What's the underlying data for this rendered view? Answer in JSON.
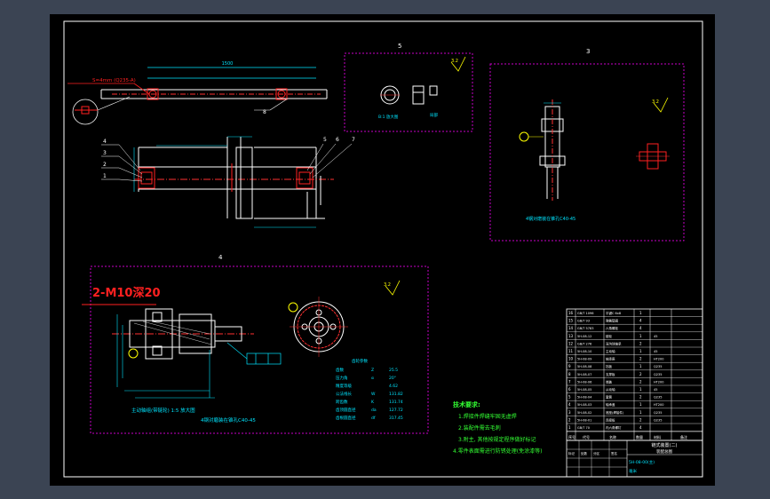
{
  "colors": {
    "workspace_bg": "#3b4453",
    "paper": "#000000",
    "frame": "#ffffff",
    "section_box": "#c800c8",
    "part_red": "#ff2020",
    "dim": "#00e5ff",
    "part": "#ffffff",
    "centerline": "#ff3030",
    "text_yellow": "#ffff00",
    "text_green": "#33ff33"
  },
  "views": {
    "section5_label": "5",
    "section3_label": "3",
    "section4_label": "4",
    "roughness_value": "3.2",
    "overall_length": "1500"
  },
  "main_view": {
    "callout_left_text": "S=4mm (Q235-A)",
    "balloons_left": [
      "4",
      "3",
      "2",
      "1"
    ],
    "balloons_right": [
      "5",
      "6",
      "7"
    ],
    "balloon_top_right": "8"
  },
  "detail5": {
    "caption_left": "B:1 放大图",
    "caption_right": "局部"
  },
  "detail3": {
    "caption": "4钢对磨装在锥孔C40-45"
  },
  "detail4": {
    "thread_note": "2-M10深20",
    "caption_left": "主动轴组(带链轮) 1:5 放大图",
    "caption_center": "4钢对磨装在锥孔C40-45"
  },
  "params_table": {
    "title": "齿轮参数",
    "rows": [
      {
        "name": "齿数",
        "sym": "Z",
        "val": "25.5"
      },
      {
        "name": "压力角",
        "sym": "α",
        "val": "20°"
      },
      {
        "name": "精度等级",
        "sym": "",
        "val": "4.62"
      },
      {
        "name": "公法线长",
        "sym": "W",
        "val": "131.82"
      },
      {
        "name": "跨齿数",
        "sym": "K",
        "val": "131.74"
      },
      {
        "name": "齿顶圆直径",
        "sym": "da",
        "val": "127.72"
      },
      {
        "name": "齿根圆直径",
        "sym": "df",
        "val": "317.45"
      }
    ]
  },
  "tech_notes": {
    "heading": "技术要求:",
    "items": [
      "1.焊接件焊缝牢固无虚焊",
      "2.装配件需去毛刺",
      "3.附主, 其他按规定程序做好标记",
      "4.零件表面需进行防锈处理(免涂漆等)"
    ]
  },
  "title_block": {
    "drawing_title": "链式装置(二)",
    "subtitle": "装配总图",
    "drawing_no": "5H-08-00(主)",
    "units": "毫米",
    "footer_labels": [
      "序号",
      "代号",
      "名称",
      "数量",
      "材料",
      "备注"
    ],
    "small_labels": [
      "标记",
      "处数",
      "分区",
      "更改文件号",
      "签名",
      "年月日"
    ]
  },
  "bom": [
    {
      "no": "16",
      "code": "GB/T 1096",
      "name": "平键C 6x8",
      "qty": "1",
      "mat": ""
    },
    {
      "no": "15",
      "code": "GB/T 93",
      "name": "弹簧垫圈",
      "qty": "4",
      "mat": ""
    },
    {
      "no": "14",
      "code": "GB/T 5783",
      "name": "六角螺栓",
      "qty": "4",
      "mat": ""
    },
    {
      "no": "13",
      "code": "5H-08-12",
      "name": "链轮",
      "qty": "1",
      "mat": "45"
    },
    {
      "no": "12",
      "code": "GB/T 276",
      "name": "深沟球轴承",
      "qty": "2",
      "mat": ""
    },
    {
      "no": "11",
      "code": "5H-08-10",
      "name": "主动轴",
      "qty": "1",
      "mat": "45"
    },
    {
      "no": "10",
      "code": "5H-08-09",
      "name": "轴承座",
      "qty": "2",
      "mat": "HT200"
    },
    {
      "no": "9",
      "code": "5H-08-08",
      "name": "挡板",
      "qty": "1",
      "mat": "Q235"
    },
    {
      "no": "8",
      "code": "5H-08-07",
      "name": "支撑板",
      "qty": "2",
      "mat": "Q235"
    },
    {
      "no": "7",
      "code": "5H-08-06",
      "name": "端盖",
      "qty": "2",
      "mat": "HT200"
    },
    {
      "no": "6",
      "code": "5H-08-05",
      "name": "从动轴",
      "qty": "1",
      "mat": "45"
    },
    {
      "no": "5",
      "code": "5H-08-04",
      "name": "套筒",
      "qty": "2",
      "mat": "Q235"
    },
    {
      "no": "4",
      "code": "5H-08-03",
      "name": "轴承盖",
      "qty": "1",
      "mat": "HT200"
    },
    {
      "no": "3",
      "code": "5H-08-02",
      "name": "底座(焊接件)",
      "qty": "1",
      "mat": "Q235"
    },
    {
      "no": "2",
      "code": "5H-08-01",
      "name": "连接板",
      "qty": "2",
      "mat": "Q235"
    },
    {
      "no": "1",
      "code": "GB/T 70",
      "name": "内六角螺钉",
      "qty": "4",
      "mat": ""
    }
  ]
}
